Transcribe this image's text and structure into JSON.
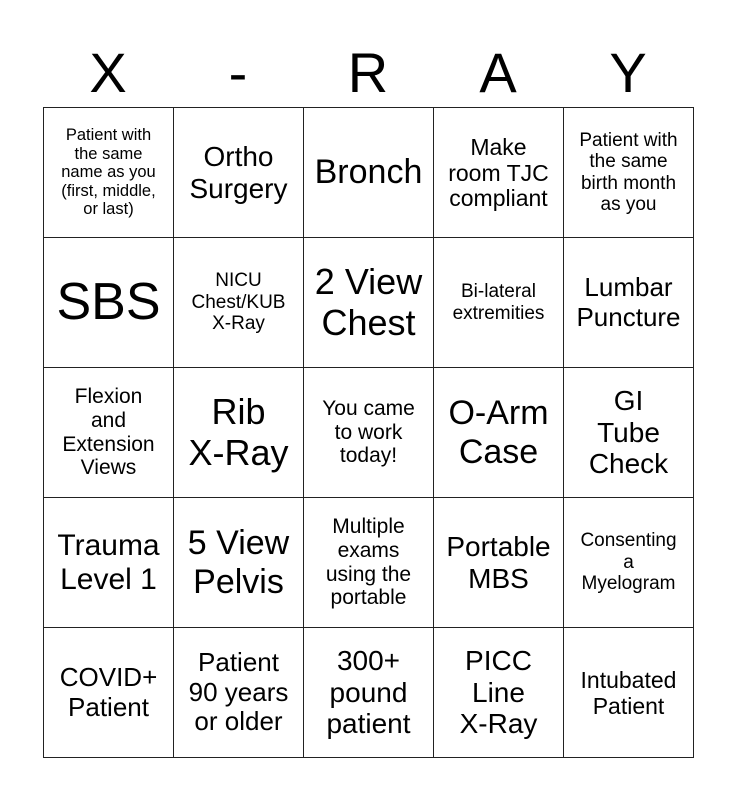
{
  "card": {
    "header_letters": [
      "X",
      "-",
      "R",
      "A",
      "Y"
    ],
    "rows": [
      [
        "Patient with\nthe same\nname as you\n(first, middle,\nor last)",
        "Ortho\nSurgery",
        "Bronch",
        "Make\nroom TJC\ncompliant",
        "Patient with\nthe same\nbirth month\nas you"
      ],
      [
        "SBS",
        "NICU\nChest/KUB\nX-Ray",
        "2 View\nChest",
        "Bi-lateral\nextremities",
        "Lumbar\nPuncture"
      ],
      [
        "Flexion\nand\nExtension\nViews",
        "Rib\nX-Ray",
        "You came\nto work\ntoday!",
        "O-Arm\nCase",
        "GI\nTube\nCheck"
      ],
      [
        "Trauma\nLevel 1",
        "5 View\nPelvis",
        "Multiple\nexams\nusing the\nportable",
        "Portable\nMBS",
        "Consenting\na\nMyelogram"
      ],
      [
        "COVID+\nPatient",
        "Patient\n90 years\nor older",
        "300+\npound\npatient",
        "PICC\nLine\nX-Ray",
        "Intubated\nPatient"
      ]
    ]
  }
}
